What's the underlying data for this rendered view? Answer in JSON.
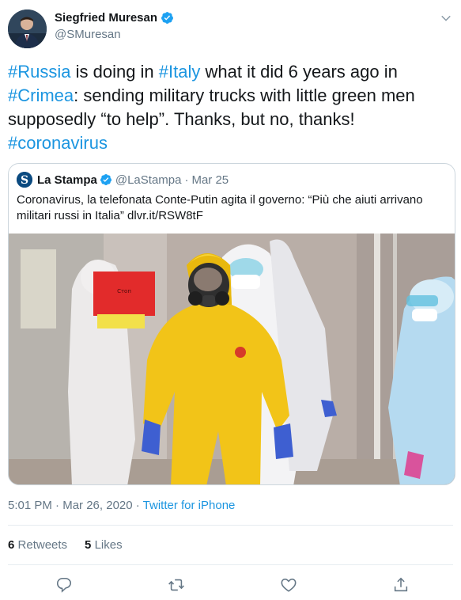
{
  "author": {
    "display_name": "Siegfried Muresan",
    "handle": "@SMuresan",
    "verified": true
  },
  "tweet": {
    "segments": [
      {
        "text": "#Russia",
        "hashtag": true
      },
      {
        "text": " is doing in ",
        "hashtag": false
      },
      {
        "text": "#Italy",
        "hashtag": true
      },
      {
        "text": " what it did 6 years ago in ",
        "hashtag": false
      },
      {
        "text": "#Crimea",
        "hashtag": true
      },
      {
        "text": ": sending military trucks with little green men supposedly “to help”. Thanks, but no, thanks! ",
        "hashtag": false
      },
      {
        "text": "#coronavirus",
        "hashtag": true
      }
    ]
  },
  "quoted": {
    "display_name": "La Stampa",
    "handle": "@LaStampa",
    "separator": "·",
    "date": "Mar 25",
    "text": "Coronavirus, la telefonata Conte-Putin agita il governo: “Più che aiuti arrivano militari russi in Italia” dlvr.it/RSW8tF",
    "sign_text": "Стоп"
  },
  "meta": {
    "time": "5:01 PM",
    "separator1": " · ",
    "date": "Mar 26, 2020",
    "separator2": " · ",
    "source": "Twitter for iPhone"
  },
  "stats": {
    "retweets_count": "6",
    "retweets_label": "Retweets",
    "likes_count": "5",
    "likes_label": "Likes"
  },
  "icons": {
    "verified": "verified-badge-icon",
    "caret": "chevron-down-icon",
    "reply": "reply-icon",
    "retweet": "retweet-icon",
    "like": "heart-icon",
    "share": "share-icon"
  },
  "colors": {
    "link": "#1b95e0",
    "verified": "#1da1f2",
    "muted": "#657786",
    "text": "#14171a",
    "suit_yellow": "#f2c418"
  }
}
